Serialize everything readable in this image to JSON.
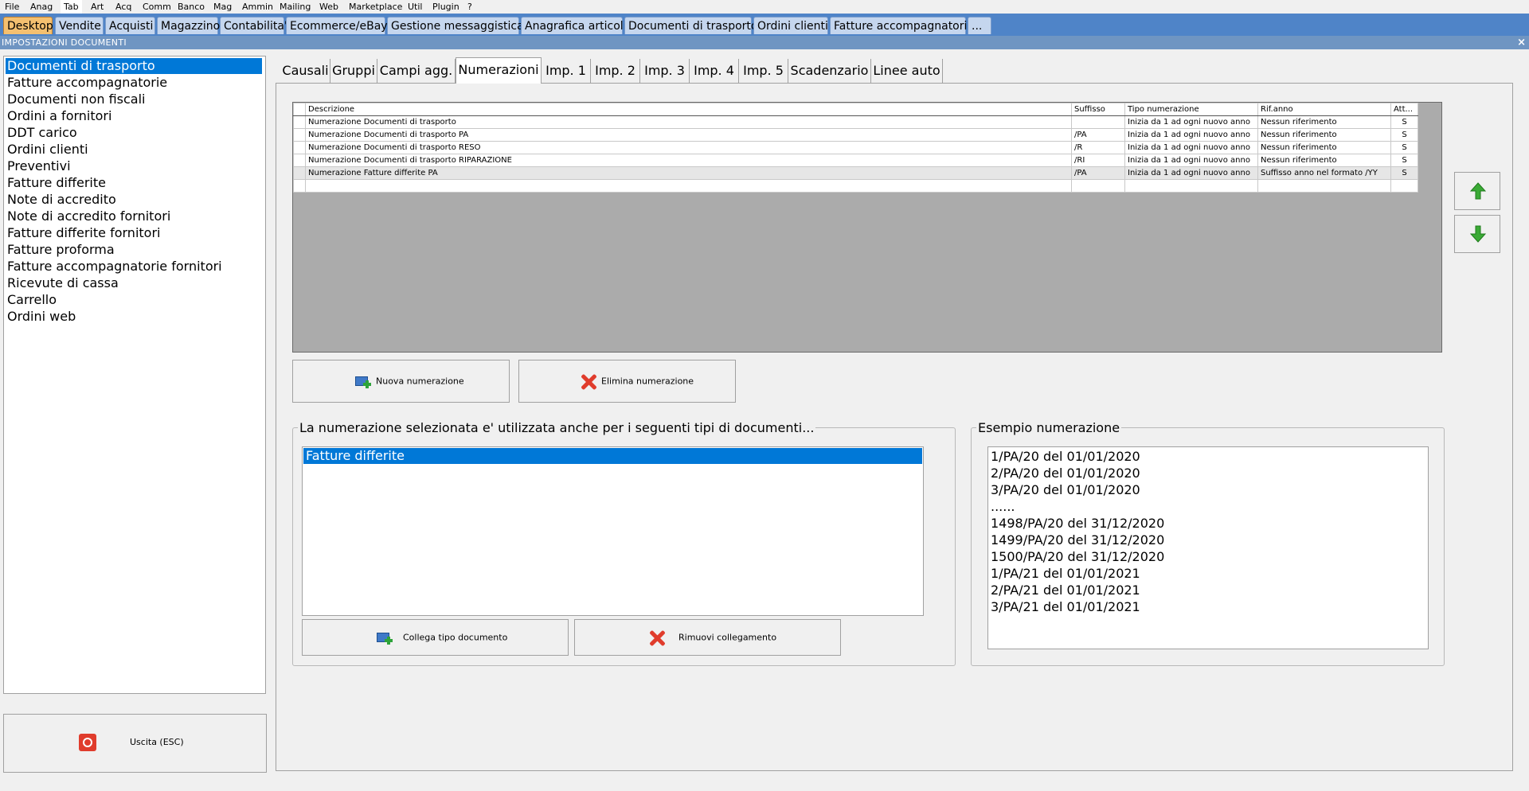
{
  "menu": [
    "File",
    "Anag",
    "Tab",
    "Art",
    "Acq",
    "Comm",
    "Banco",
    "Mag",
    "Ammin",
    "Mailing",
    "Web",
    "Marketplace",
    "Util",
    "Plugin",
    "?"
  ],
  "desktop_tabs": [
    "Desktop",
    "Vendite",
    "Acquisti",
    "Magazzino",
    "Contabilita'",
    "Ecommerce/eBay",
    "Gestione messaggistica",
    "Anagrafica articoli",
    "Documenti di trasporto",
    "Ordini clienti",
    "Fatture accompagnatorie",
    "..."
  ],
  "window": {
    "title": "IMPOSTAZIONI DOCUMENTI",
    "close": "×"
  },
  "doc_types": [
    "Documenti di trasporto",
    "Fatture accompagnatorie",
    "Documenti non fiscali",
    "Ordini a fornitori",
    "DDT carico",
    "Ordini clienti",
    "Preventivi",
    "Fatture differite",
    "Note di accredito",
    "Note di accredito fornitori",
    "Fatture differite fornitori",
    "Fatture proforma",
    "Fatture accompagnatorie fornitori",
    "Ricevute di cassa",
    "Carrello",
    "Ordini web"
  ],
  "exit_label": "Uscita (ESC)",
  "settings_tabs": [
    "Causali",
    "Gruppi",
    "Campi agg.",
    "Numerazioni",
    "Imp. 1",
    "Imp. 2",
    "Imp. 3",
    "Imp. 4",
    "Imp. 5",
    "Scadenzario",
    "Linee auto"
  ],
  "grid": {
    "headers": [
      "Descrizione",
      "Suffisso",
      "Tipo numerazione",
      "Rif.anno",
      "Att..."
    ],
    "rows": [
      [
        "Numerazione Documenti di trasporto",
        "",
        "Inizia da 1 ad ogni nuovo anno",
        "Nessun riferimento",
        "S"
      ],
      [
        "Numerazione Documenti di trasporto PA",
        "/PA",
        "Inizia da 1 ad ogni nuovo anno",
        "Nessun riferimento",
        "S"
      ],
      [
        "Numerazione Documenti di trasporto RESO",
        "/R",
        "Inizia da 1 ad ogni nuovo anno",
        "Nessun riferimento",
        "S"
      ],
      [
        "Numerazione Documenti di trasporto RIPARAZIONE",
        "/RI",
        "Inizia da 1 ad ogni nuovo anno",
        "Nessun riferimento",
        "S"
      ],
      [
        "Numerazione Fatture differite PA",
        "/PA",
        "Inizia da 1 ad ogni nuovo anno",
        "Suffisso anno nel formato /YY",
        "S"
      ]
    ]
  },
  "buttons": {
    "new_numbering": "Nuova numerazione",
    "delete_numbering": "Elimina numerazione",
    "link_doc_type": "Collega tipo documento",
    "remove_link": "Rimuovi collegamento"
  },
  "linked_group": {
    "legend": "La numerazione selezionata e' utilizzata anche per i seguenti tipi di documenti...",
    "items": [
      "Fatture differite"
    ]
  },
  "example_group": {
    "legend": "Esempio numerazione",
    "lines": [
      "1/PA/20 del 01/01/2020",
      "2/PA/20 del 01/01/2020",
      "3/PA/20 del 01/01/2020",
      "......",
      "1498/PA/20 del 31/12/2020",
      "1499/PA/20 del 31/12/2020",
      "1500/PA/20 del 31/12/2020",
      "1/PA/21 del 01/01/2021",
      "2/PA/21 del 01/01/2021",
      "3/PA/21 del 01/01/2021"
    ]
  },
  "colors": {
    "selection": "#0078d7",
    "tabbar": "#4f84c8",
    "titlebar": "#6f95c2",
    "active_desktop_tab": "#f4c070",
    "arrow_green": "#3aaa35"
  }
}
